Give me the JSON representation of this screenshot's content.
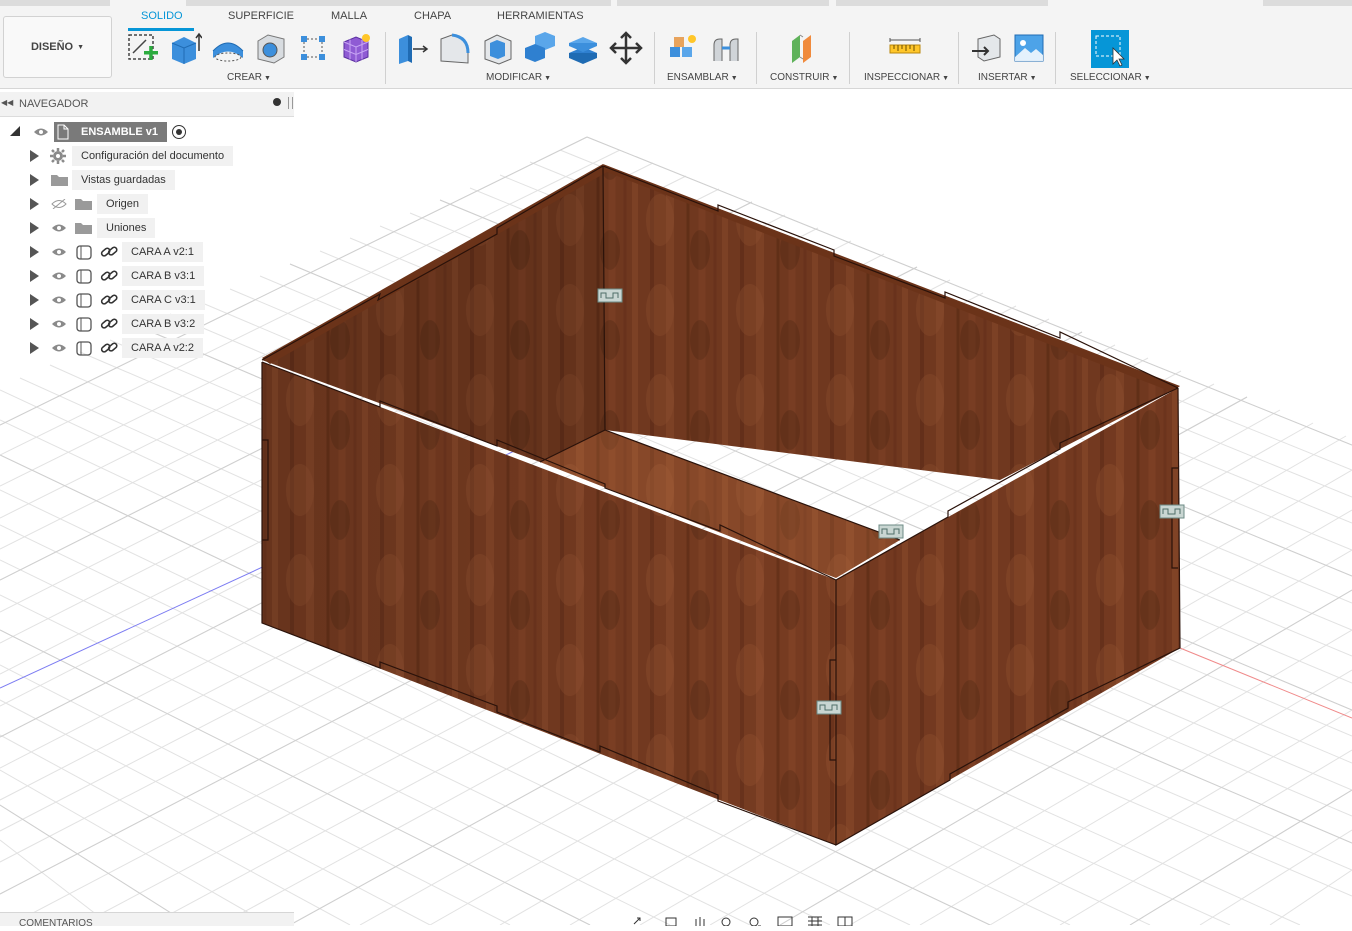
{
  "workspace": {
    "label": "DISEÑO"
  },
  "tabs": [
    "SOLIDO",
    "SUPERFICIE",
    "MALLA",
    "CHAPA",
    "HERRAMIENTAS"
  ],
  "active_tab": "SOLIDO",
  "groups": {
    "crear": "CREAR",
    "modificar": "MODIFICAR",
    "ensamblar": "ENSAMBLAR",
    "construir": "CONSTRUIR",
    "inspeccionar": "INSPECCIONAR",
    "insertar": "INSERTAR",
    "seleccionar": "SELECCIONAR"
  },
  "icons": {
    "crear": [
      "create-sketch-icon",
      "extrude-icon",
      "revolve-icon",
      "hole-icon",
      "rectangular-pattern-icon",
      "create-form-icon"
    ],
    "modificar": [
      "press-pull-icon",
      "fillet-icon",
      "shell-icon",
      "combine-icon",
      "offset-face-icon",
      "move-icon"
    ],
    "ensamblar": [
      "new-component-icon",
      "joint-icon"
    ],
    "construir": [
      "offset-plane-icon"
    ],
    "inspeccionar": [
      "measure-icon"
    ],
    "insertar": [
      "insert-derive-icon",
      "canvas-image-icon"
    ],
    "seleccionar": [
      "window-select-icon"
    ]
  },
  "accent_color": "#0696d7",
  "browser": {
    "title": "NAVEGADOR",
    "root": "ENSAMBLE v1",
    "items": [
      {
        "label": "Configuración del documento",
        "icon": "gear-icon",
        "visible": null
      },
      {
        "label": "Vistas guardadas",
        "icon": "folder-icon",
        "visible": null
      },
      {
        "label": "Origen",
        "icon": "folder-icon",
        "visible": false
      },
      {
        "label": "Uniones",
        "icon": "folder-icon",
        "visible": true
      },
      {
        "label": "CARA A v2:1",
        "icon": "component-link-icon",
        "visible": true
      },
      {
        "label": "CARA B v3:1",
        "icon": "component-link-icon",
        "visible": true
      },
      {
        "label": "CARA C v3:1",
        "icon": "component-link-icon",
        "visible": true
      },
      {
        "label": "CARA B v3:2",
        "icon": "component-link-icon",
        "visible": true
      },
      {
        "label": "CARA A v2:2",
        "icon": "component-link-icon",
        "visible": true
      }
    ]
  },
  "comments": {
    "title": "COMENTARIOS"
  },
  "model": {
    "material_color": "#7a3d22",
    "joint_glyph": "joint-marker-icon"
  }
}
